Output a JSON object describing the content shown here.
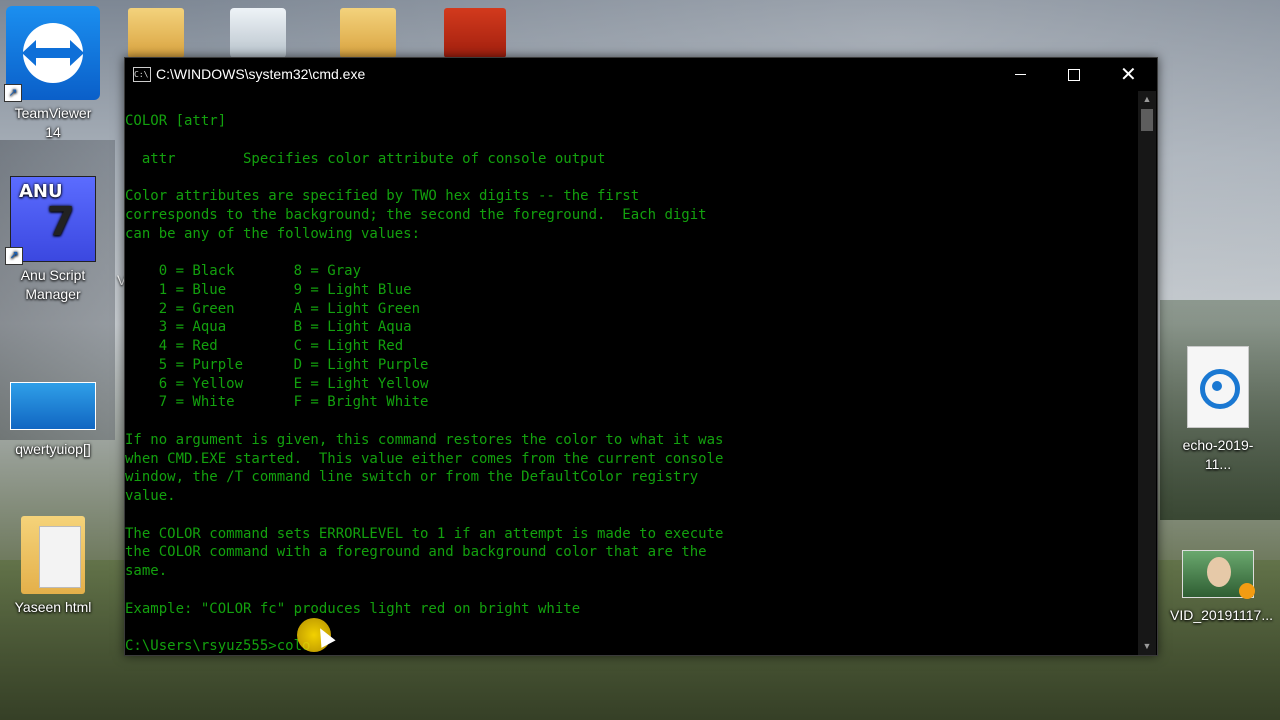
{
  "desktop": {
    "icons": [
      {
        "label": "TeamViewer 14"
      },
      {
        "label": "Anu Script Manager"
      },
      {
        "label": "qwertyuiop[]"
      },
      {
        "label": "Yaseen html"
      },
      {
        "label": "echo-2019-11..."
      },
      {
        "label": "VID_20191117..."
      }
    ],
    "anu_icon_text_top": "ANU",
    "anu_icon_text_num": "7",
    "partial_label": "V"
  },
  "window": {
    "title": "C:\\WINDOWS\\system32\\cmd.exe",
    "icon_text": "C:\\",
    "text_color": "#13a10e",
    "background": "#000000"
  },
  "console": {
    "lines": [
      "COLOR [attr]",
      "",
      "  attr        Specifies color attribute of console output",
      "",
      "Color attributes are specified by TWO hex digits -- the first",
      "corresponds to the background; the second the foreground.  Each digit",
      "can be any of the following values:",
      "",
      "    0 = Black       8 = Gray",
      "    1 = Blue        9 = Light Blue",
      "    2 = Green       A = Light Green",
      "    3 = Aqua        B = Light Aqua",
      "    4 = Red         C = Light Red",
      "    5 = Purple      D = Light Purple",
      "    6 = Yellow      E = Light Yellow",
      "    7 = White       F = Bright White",
      "",
      "If no argument is given, this command restores the color to what it was",
      "when CMD.EXE started.  This value either comes from the current console",
      "window, the /T command line switch or from the DefaultColor registry",
      "value.",
      "",
      "The COLOR command sets ERRORLEVEL to 1 if an attempt is made to execute",
      "the COLOR command with a foreground and background color that are the",
      "same.",
      "",
      "Example: \"COLOR fc\" produces light red on bright white",
      "",
      "C:\\Users\\rsyuz555>colo"
    ]
  }
}
